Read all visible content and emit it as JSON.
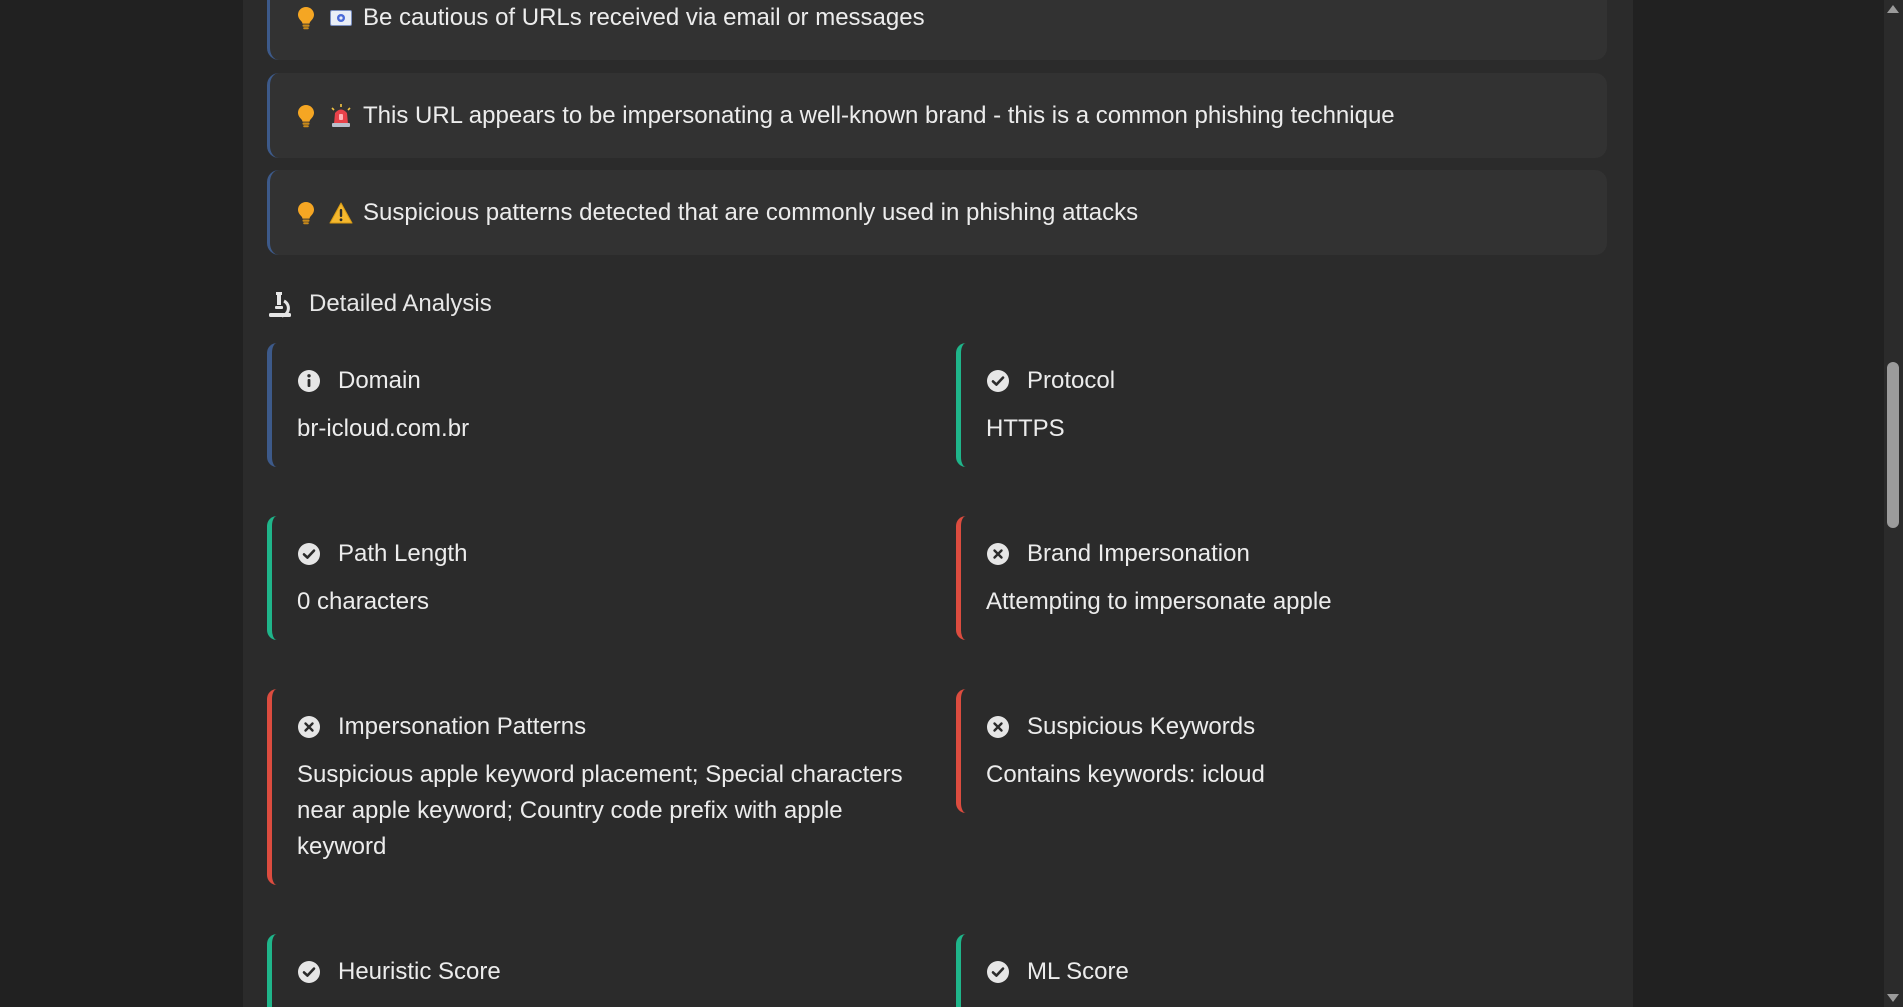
{
  "tips": [
    {
      "text": "Be cautious of URLs received via email or messages",
      "emoji": "email-icon"
    },
    {
      "text": "This URL appears to be impersonating a well-known brand - this is a common phishing technique",
      "emoji": "siren-icon"
    },
    {
      "text": "Suspicious patterns detected that are commonly used in phishing attacks",
      "emoji": "warning-icon"
    }
  ],
  "section": {
    "title": "Detailed Analysis",
    "icon": "microscope-icon"
  },
  "cards": [
    {
      "label": "Domain",
      "value": "br-icloud.com.br",
      "status": "info",
      "color": "#3d5a8a"
    },
    {
      "label": "Protocol",
      "value": "HTTPS",
      "status": "pass",
      "color": "#1fb58a"
    },
    {
      "label": "Path Length",
      "value": "0 characters",
      "status": "pass",
      "color": "#1fb58a"
    },
    {
      "label": "Brand Impersonation",
      "value": "Attempting to impersonate apple",
      "status": "fail",
      "color": "#dc4c3f"
    },
    {
      "label": "Impersonation Patterns",
      "value": "Suspicious apple keyword placement; Special characters near apple keyword; Country code prefix with apple keyword",
      "status": "fail",
      "color": "#dc4c3f"
    },
    {
      "label": "Suspicious Keywords",
      "value": "Contains keywords: icloud",
      "status": "fail",
      "color": "#dc4c3f"
    },
    {
      "label": "Heuristic Score",
      "value": "",
      "status": "pass",
      "color": "#1fb58a"
    },
    {
      "label": "ML Score",
      "value": "",
      "status": "pass",
      "color": "#1fb58a"
    }
  ],
  "colors": {
    "accent_blue": "#3d5a8a",
    "success": "#1fb58a",
    "danger": "#dc4c3f",
    "bulb": "#f5a623"
  }
}
